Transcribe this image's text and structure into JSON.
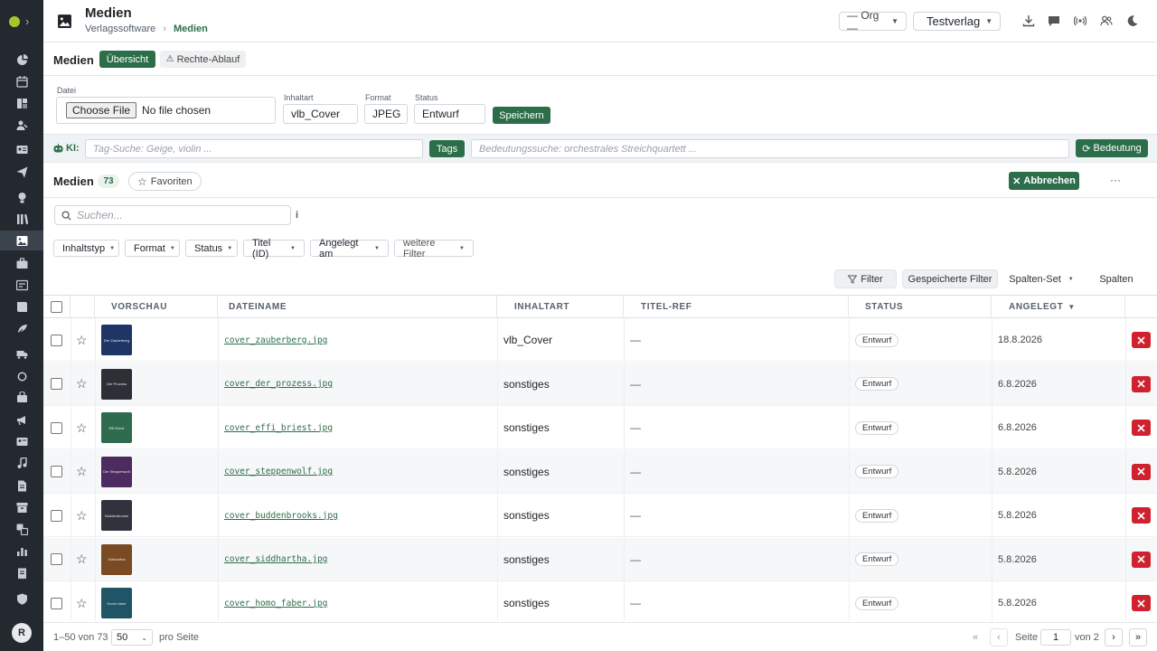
{
  "header": {
    "title": "Medien",
    "breadcrumb": [
      "Verlagssoftware",
      "Medien"
    ],
    "org_select": "— Org —",
    "publisher_select": "Testverlag"
  },
  "module": {
    "title": "Medien",
    "tab_overview": "Übersicht",
    "tab_rights": "Rechte-Ablauf"
  },
  "upload": {
    "file_label": "Datei",
    "choose_button": "Choose File",
    "no_file": "No file chosen",
    "content_type_label": "Inhaltart",
    "content_type_value": "vlb_Cover",
    "format_label": "Format",
    "format_value": "JPEG",
    "status_label": "Status",
    "status_value": "Entwurf",
    "save_button": "Speichern"
  },
  "ai": {
    "label": "KI:",
    "tag_placeholder": "Tag-Suche: Geige, violin ...",
    "tags_button": "Tags",
    "meaning_placeholder": "Bedeutungssuche: orchestrales Streichquartett ...",
    "meaning_button": "Bedeutung"
  },
  "list": {
    "title": "Medien",
    "count": "73",
    "favorites": "Favoriten",
    "cancel_button": "Abbrechen",
    "more": "···",
    "search_placeholder": "Suchen...",
    "info": "i",
    "filter_chips": [
      "Inhaltstyp",
      "Format",
      "Status",
      "Titel (ID)",
      "Angelegt am",
      "weitere Filter"
    ],
    "filter_button": "Filter",
    "saved_filters": "Gespeicherte Filter",
    "column_set": "Spalten-Set",
    "columns": "Spalten"
  },
  "table": {
    "headers": [
      "VORSCHAU",
      "DATEINAME",
      "INHALTART",
      "TITEL-REF",
      "STATUS",
      "ANGELEGT"
    ],
    "sort_indicator": "▼",
    "rows": [
      {
        "thumb_text": "Der Zauberberg",
        "thumb_color": "#1e3566",
        "filename": "cover_zauberberg.jpg",
        "type": "vlb_Cover",
        "title_ref": "—",
        "status": "Entwurf",
        "created": "18.8.2026"
      },
      {
        "thumb_text": "Der Prozess",
        "thumb_color": "#2c2f35",
        "filename": "cover_der_prozess.jpg",
        "type": "sonstiges",
        "title_ref": "—",
        "status": "Entwurf",
        "created": "6.8.2026"
      },
      {
        "thumb_text": "Effi Briest",
        "thumb_color": "#2f6b4f",
        "filename": "cover_effi_briest.jpg",
        "type": "sonstiges",
        "title_ref": "—",
        "status": "Entwurf",
        "created": "6.8.2026"
      },
      {
        "thumb_text": "Der Steppenwolf",
        "thumb_color": "#4d2a5f",
        "filename": "cover_steppenwolf.jpg",
        "type": "sonstiges",
        "title_ref": "—",
        "status": "Entwurf",
        "created": "5.8.2026"
      },
      {
        "thumb_text": "Buddenbrooks",
        "thumb_color": "#30323c",
        "filename": "cover_buddenbrooks.jpg",
        "type": "sonstiges",
        "title_ref": "—",
        "status": "Entwurf",
        "created": "5.8.2026"
      },
      {
        "thumb_text": "Siddhartha",
        "thumb_color": "#7a4a22",
        "filename": "cover_siddhartha.jpg",
        "type": "sonstiges",
        "title_ref": "—",
        "status": "Entwurf",
        "created": "5.8.2026"
      },
      {
        "thumb_text": "Homo faber",
        "thumb_color": "#1f5566",
        "filename": "cover_homo_faber.jpg",
        "type": "sonstiges",
        "title_ref": "—",
        "status": "Entwurf",
        "created": "5.8.2026"
      }
    ]
  },
  "footer": {
    "range": "1–50 von 73",
    "per_page": "50",
    "per_page_label": "pro Seite",
    "page_label": "Seite",
    "page": "1",
    "of_pages": "von 2"
  },
  "user": {
    "initial": "R"
  },
  "colors": {
    "accent": "#2d6e4a",
    "danger": "#cf222e",
    "sidebar": "#24292f"
  },
  "icons": {
    "sidebar": [
      "dashboard-icon",
      "calendar-icon",
      "kanban-icon",
      "users-icon",
      "contacts-icon",
      "send-icon",
      "lightbulb-icon",
      "library-icon",
      "image-icon",
      "briefcase-icon",
      "layout-icon",
      "book-icon",
      "feather-icon",
      "truck-icon",
      "circle-icon",
      "bag-icon",
      "megaphone-icon",
      "id-card-icon",
      "music-icon",
      "file-icon",
      "archive-icon",
      "translate-icon",
      "chart-icon",
      "receipt-icon",
      "shield-icon"
    ],
    "header": [
      "download-icon",
      "comment-icon",
      "broadcast-icon",
      "team-icon",
      "moon-icon"
    ]
  }
}
